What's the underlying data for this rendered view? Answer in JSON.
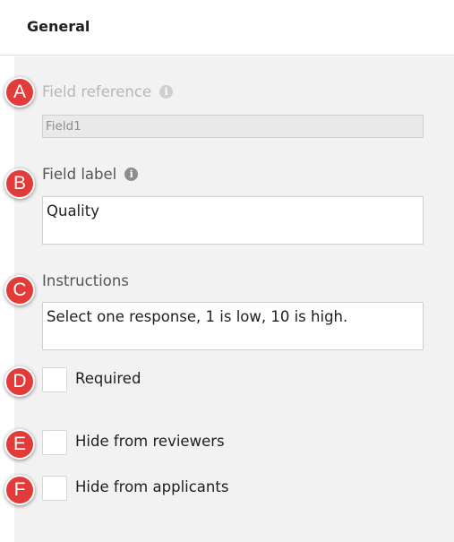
{
  "header": {
    "title": "General"
  },
  "fields": {
    "field_reference": {
      "label": "Field reference",
      "value": "Field1"
    },
    "field_label": {
      "label": "Field label",
      "value": "Quality"
    },
    "instructions": {
      "label": "Instructions",
      "value": "Select one response, 1 is low, 10 is high."
    }
  },
  "checkboxes": {
    "required": {
      "label": "Required",
      "checked": false
    },
    "hide_reviewers": {
      "label": "Hide from reviewers",
      "checked": false
    },
    "hide_applicants": {
      "label": "Hide from applicants",
      "checked": false
    }
  },
  "markers": [
    "A",
    "B",
    "C",
    "D",
    "E",
    "F"
  ],
  "icons": {
    "info": "info-icon"
  },
  "colors": {
    "marker": "#e23b39",
    "panel": "#f2f2f2"
  }
}
